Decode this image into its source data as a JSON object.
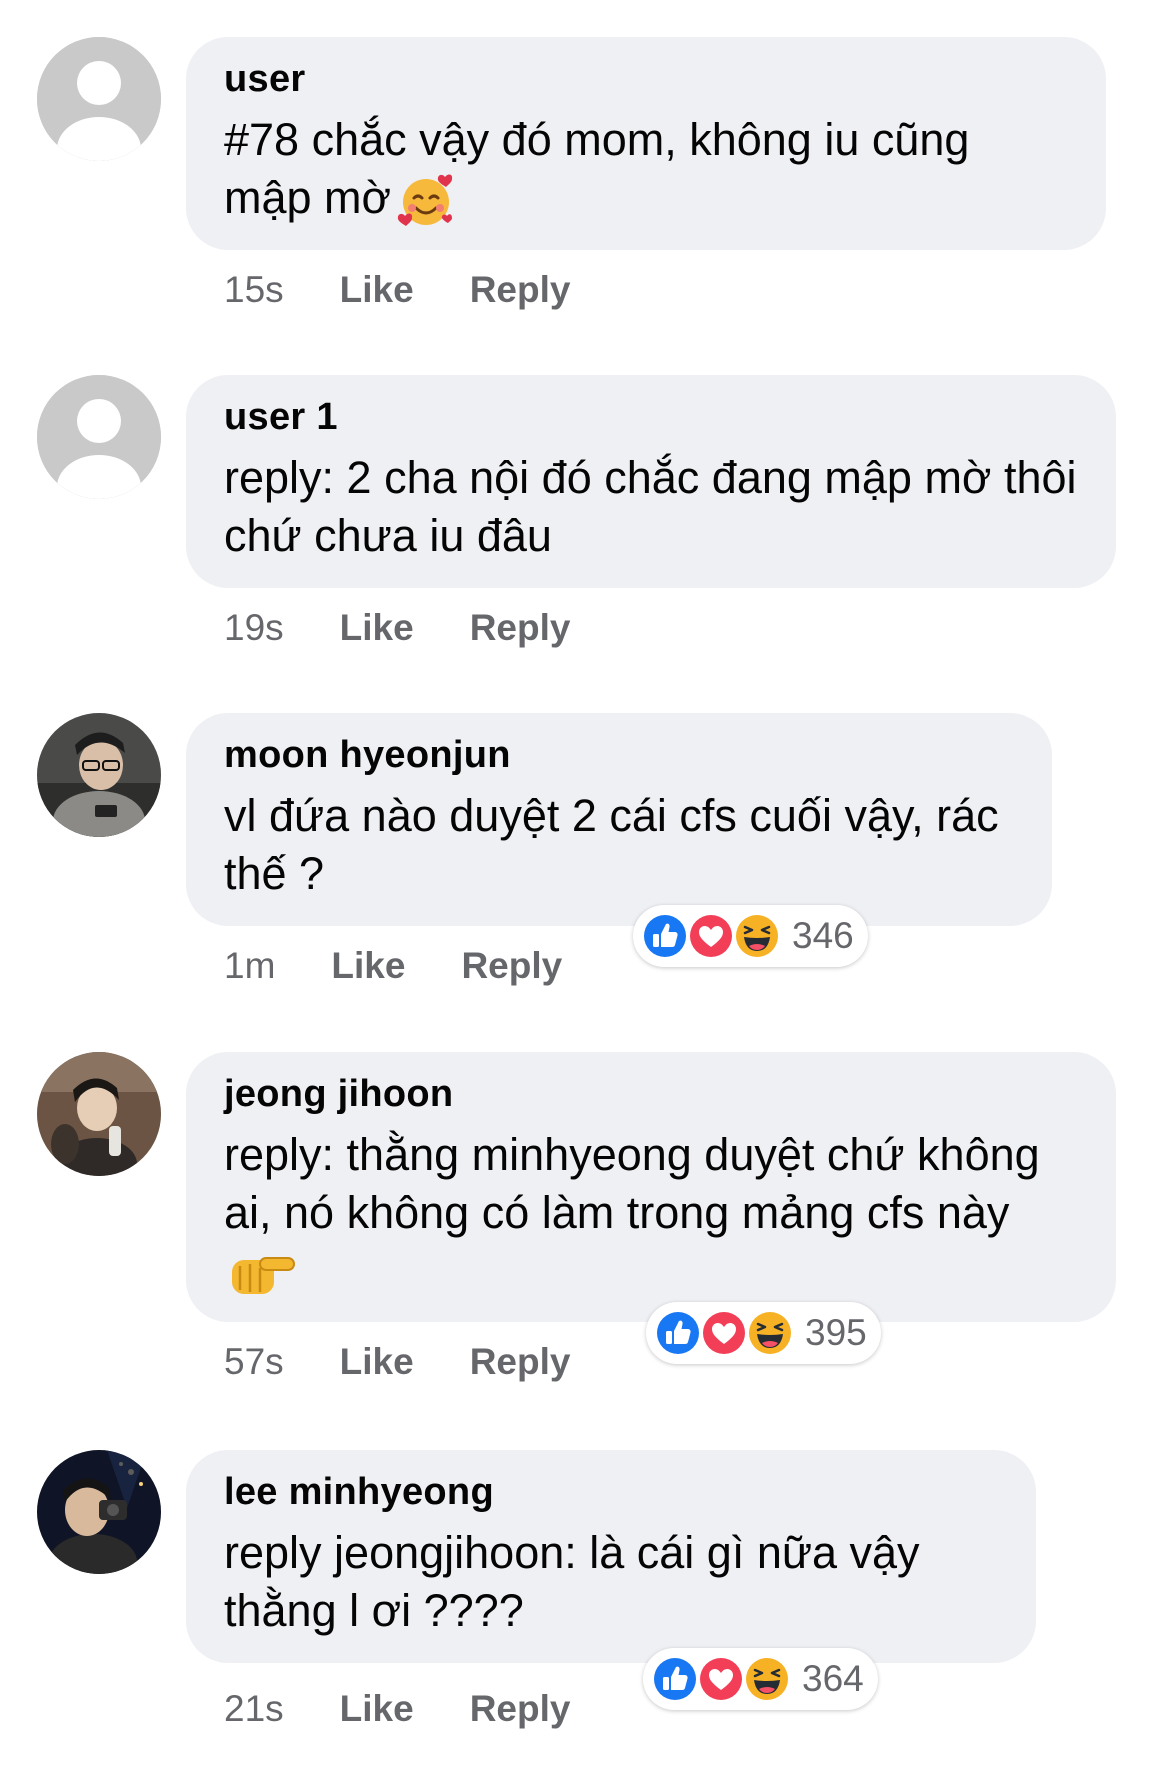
{
  "comments": [
    {
      "author": "user",
      "text": "#78 chắc vậy đó mom, không iu cũng mập mờ",
      "emoji": "smiling-face-with-hearts",
      "time": "15s",
      "like": "Like",
      "reply": "Reply",
      "avatar": "default-avatar"
    },
    {
      "author": "user 1",
      "text": "reply: 2 cha nội đó chắc đang mập mờ thôi chứ chưa iu đâu",
      "time": "19s",
      "like": "Like",
      "reply": "Reply",
      "avatar": "default-avatar"
    },
    {
      "author": "moon hyeonjun",
      "text": "vl đứa nào duyệt 2 cái cfs cuối vậy, rác thế ?",
      "time": "1m",
      "like": "Like",
      "reply": "Reply",
      "avatar": "photo-avatar",
      "reactions": {
        "icons": [
          "like-icon",
          "love-icon",
          "haha-icon"
        ],
        "count": "346"
      }
    },
    {
      "author": "jeong jihoon",
      "text": "reply: thằng minhyeong duyệt chứ không ai, nó không có làm trong mảng cfs này",
      "emoji": "backhand-index-pointing-right",
      "time": "57s",
      "like": "Like",
      "reply": "Reply",
      "avatar": "photo-avatar",
      "reactions": {
        "icons": [
          "like-icon",
          "love-icon",
          "haha-icon"
        ],
        "count": "395"
      }
    },
    {
      "author": "lee minhyeong",
      "text": "reply jeongjihoon: là cái gì nữa vậy thằng l ơi ????",
      "time": "21s",
      "like": "Like",
      "reply": "Reply",
      "avatar": "photo-avatar",
      "reactions": {
        "icons": [
          "like-icon",
          "love-icon",
          "haha-icon"
        ],
        "count": "364"
      }
    }
  ],
  "colors": {
    "bubble": "#eff0f4",
    "secondary_text": "#65676b",
    "like_blue": "#1877f2",
    "love_red": "#f33e58",
    "haha_yellow": "#f7b125"
  }
}
